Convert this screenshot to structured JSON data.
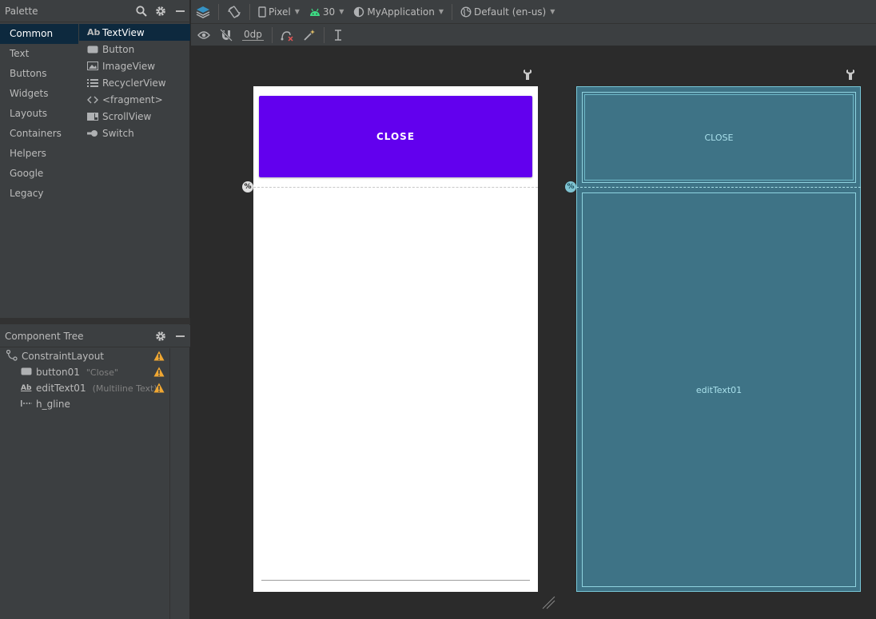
{
  "palette": {
    "title": "Palette",
    "categories": [
      "Common",
      "Text",
      "Buttons",
      "Widgets",
      "Layouts",
      "Containers",
      "Helpers",
      "Google",
      "Legacy"
    ],
    "items": [
      {
        "label": "TextView",
        "icon": "textview-icon"
      },
      {
        "label": "Button",
        "icon": "button-icon"
      },
      {
        "label": "ImageView",
        "icon": "imageview-icon"
      },
      {
        "label": "RecyclerView",
        "icon": "recyclerview-icon"
      },
      {
        "label": "<fragment>",
        "icon": "fragment-icon"
      },
      {
        "label": "ScrollView",
        "icon": "scrollview-icon"
      },
      {
        "label": "Switch",
        "icon": "switch-icon"
      }
    ],
    "selected_category": "Common",
    "selected_item": "TextView"
  },
  "component_tree": {
    "title": "Component Tree",
    "nodes": [
      {
        "label": "ConstraintLayout",
        "hint": "",
        "warning": true
      },
      {
        "label": "button01",
        "hint": "\"Close\"",
        "warning": true
      },
      {
        "label": "editText01",
        "hint": "(Multiline Text)",
        "warning": true
      },
      {
        "label": "h_gline",
        "hint": "",
        "warning": false
      }
    ]
  },
  "toolbar": {
    "device": "Pixel",
    "api_level": "30",
    "theme": "MyApplication",
    "locale": "Default (en-us)",
    "default_margin": "0dp"
  },
  "design": {
    "button_text": "CLOSE",
    "blueprint_button_text": "CLOSE",
    "blueprint_edit_text": "editText01",
    "guideline_marker": "%"
  },
  "colors": {
    "accent_purple": "#6200ee",
    "blueprint_bg": "#3e7386",
    "warning": "#f0a732",
    "selection": "#0d293e"
  }
}
